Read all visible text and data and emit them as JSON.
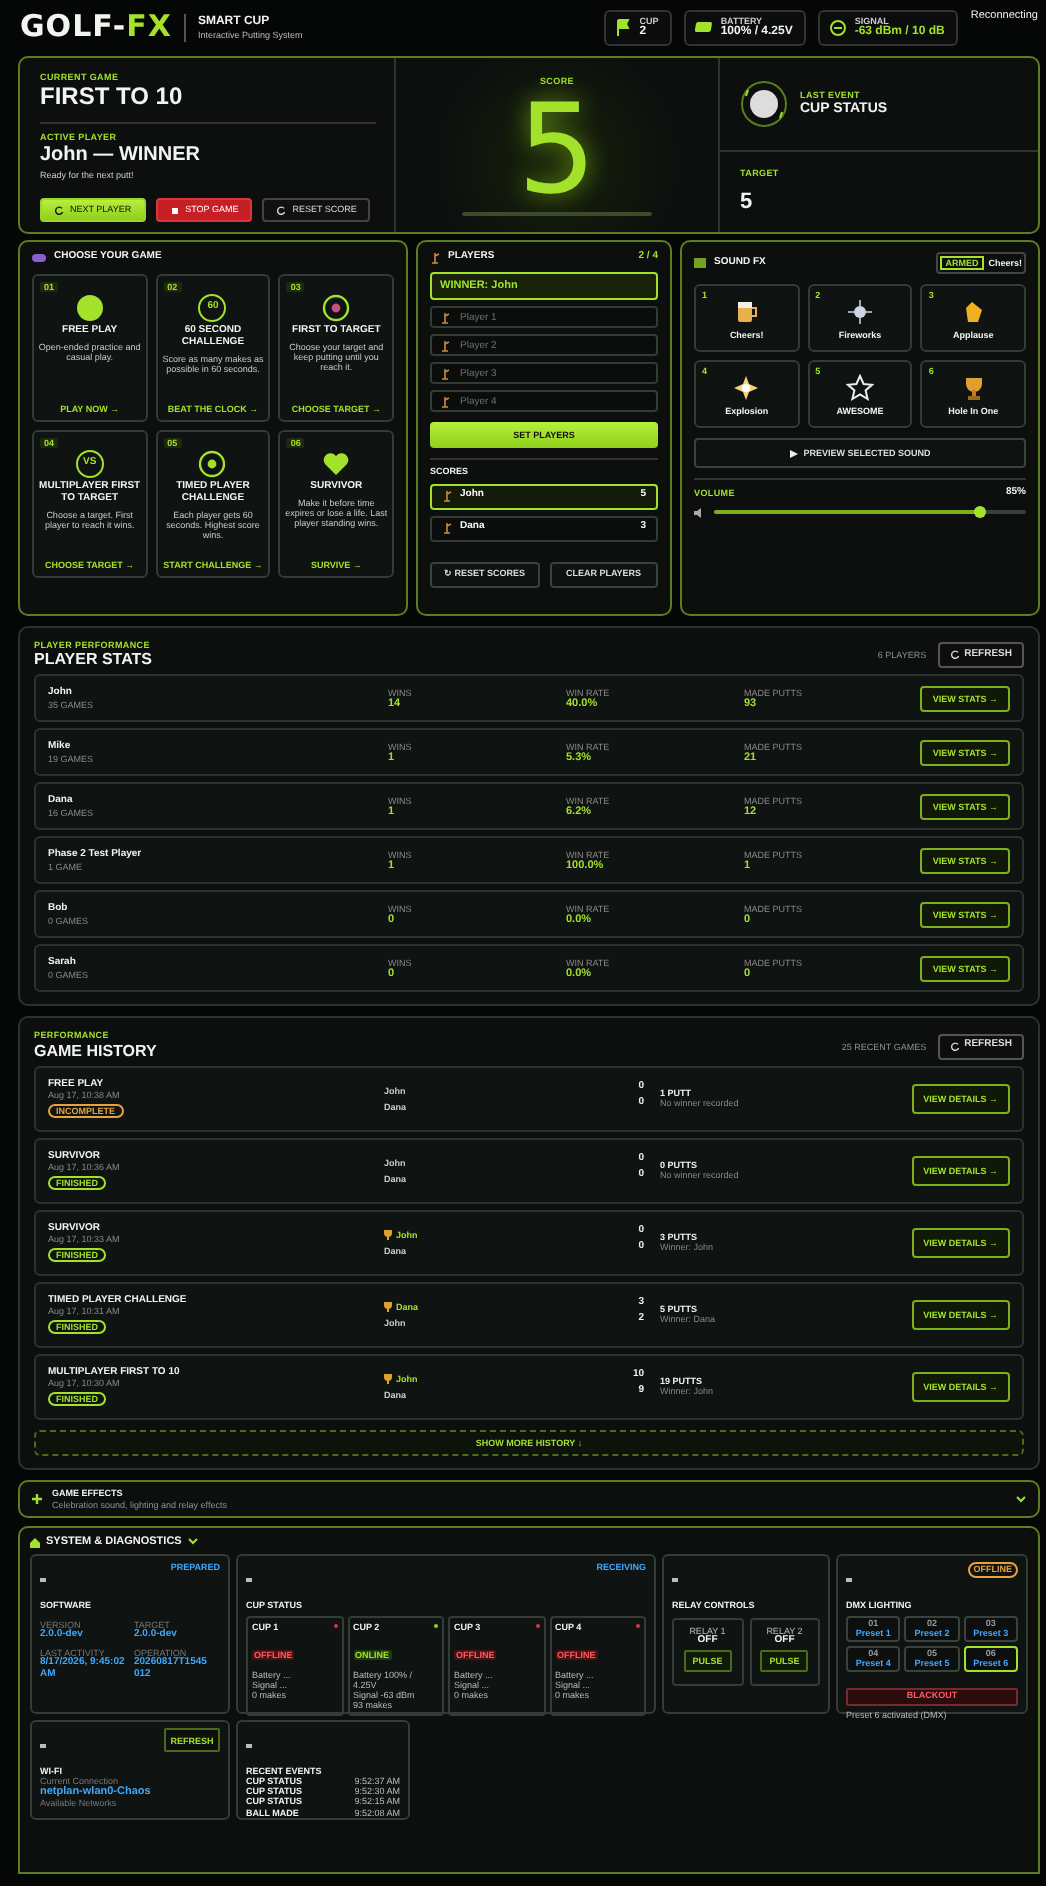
{
  "header": {
    "logo": {
      "main": "GOLF-",
      "accent": "FX"
    },
    "title": "SMART CUP",
    "subtitle": "Interactive Putting System",
    "chips": [
      {
        "kind": "flag",
        "label": "CUP",
        "value": "2"
      },
      {
        "kind": "battery",
        "label": "BATTERY",
        "value": "100% / 4.25V"
      },
      {
        "kind": "signal",
        "label": "SIGNAL",
        "value": "-63 dBm / 10 dB"
      }
    ],
    "connection": "Reconnecting"
  },
  "hero": {
    "game_label": "CURRENT GAME",
    "game": "FIRST TO 10",
    "player_label": "ACTIVE PLAYER",
    "player": "John — WINNER",
    "hint": "Ready for the next putt!",
    "buttons": [
      {
        "kind": "primary",
        "label": "NEXT PLAYER"
      },
      {
        "kind": "danger",
        "label": "STOP GAME"
      },
      {
        "kind": "outline",
        "label": "RESET SCORE"
      }
    ],
    "score_label": "SCORE",
    "score": "5",
    "event_label": "LAST EVENT",
    "event": "CUP STATUS",
    "target_label": "TARGET",
    "target": "5"
  },
  "games": {
    "title": "CHOOSE YOUR GAME",
    "cards": [
      {
        "number": "01",
        "title": "FREE PLAY",
        "description": "Open-ended practice and casual play.",
        "link": "PLAY NOW →"
      },
      {
        "number": "02",
        "icon_text": "60",
        "title": "60 SECOND CHALLENGE",
        "description": "Score as many makes as possible in 60 seconds.",
        "link": "BEAT THE CLOCK →"
      },
      {
        "number": "03",
        "title": "FIRST TO TARGET",
        "description": "Choose your target and keep putting until you reach it.",
        "link": "CHOOSE TARGET →"
      },
      {
        "number": "04",
        "icon_text": "VS",
        "title": "MULTIPLAYER FIRST TO TARGET",
        "description": "Choose a target. First player to reach it wins.",
        "link": "CHOOSE TARGET →"
      },
      {
        "number": "05",
        "title": "TIMED PLAYER CHALLENGE",
        "description": "Each player gets 60 seconds. Highest score wins.",
        "link": "START CHALLENGE →"
      },
      {
        "number": "06",
        "title": "SURVIVOR",
        "description": "Make it before time expires or lose a life. Last player standing wins.",
        "link": "SURVIVE →"
      }
    ]
  },
  "players": {
    "title": "PLAYERS",
    "count": "2 / 4",
    "winner_field": "WINNER: John",
    "inputs": [
      {
        "placeholder": "Player 1"
      },
      {
        "placeholder": "Player 2"
      },
      {
        "placeholder": "Player 3"
      },
      {
        "placeholder": "Player 4"
      }
    ],
    "set_button": "SET PLAYERS",
    "scores_label": "SCORES",
    "scores": [
      {
        "name": "John",
        "score": "5",
        "selected": true
      },
      {
        "name": "Dana",
        "score": "3",
        "selected": false
      }
    ],
    "buttons": [
      "↻ RESET SCORES",
      "CLEAR PLAYERS"
    ]
  },
  "sound": {
    "title": "SOUND FX",
    "toggle": {
      "badge": "ARMED",
      "value": "Cheers!"
    },
    "effects": [
      {
        "number": "1",
        "label": "Cheers!",
        "selected": false
      },
      {
        "number": "2",
        "label": "Fireworks",
        "selected": false
      },
      {
        "number": "3",
        "label": "Applause",
        "selected": false
      },
      {
        "number": "4",
        "label": "Explosion",
        "selected": false
      },
      {
        "number": "5",
        "label": "AWESOME",
        "selected": false
      },
      {
        "number": "6",
        "label": "Hole In One",
        "selected": false
      }
    ],
    "preview_button": "PREVIEW SELECTED SOUND",
    "volume_label": "VOLUME",
    "volume_reading": "85%",
    "level": 0.85
  },
  "player_stats": {
    "kicker": "PLAYER PERFORMANCE",
    "title": "PLAYER STATS",
    "count": "6 PLAYERS",
    "refresh": "REFRESH",
    "rows": [
      {
        "name": "John",
        "games": "35 GAMES",
        "stats": [
          {
            "label": "WINS",
            "value": "14"
          },
          {
            "label": "WIN RATE",
            "value": "40.0%"
          },
          {
            "label": "MADE PUTTS",
            "value": "93"
          }
        ],
        "button": "VIEW STATS →"
      },
      {
        "name": "Mike",
        "games": "19 GAMES",
        "stats": [
          {
            "label": "WINS",
            "value": "1"
          },
          {
            "label": "WIN RATE",
            "value": "5.3%"
          },
          {
            "label": "MADE PUTTS",
            "value": "21"
          }
        ],
        "button": "VIEW STATS →"
      },
      {
        "name": "Dana",
        "games": "16 GAMES",
        "stats": [
          {
            "label": "WINS",
            "value": "1"
          },
          {
            "label": "WIN RATE",
            "value": "6.2%"
          },
          {
            "label": "MADE PUTTS",
            "value": "12"
          }
        ],
        "button": "VIEW STATS →"
      },
      {
        "name": "Phase 2 Test Player",
        "games": "1 GAME",
        "stats": [
          {
            "label": "WINS",
            "value": "1"
          },
          {
            "label": "WIN RATE",
            "value": "100.0%"
          },
          {
            "label": "MADE PUTTS",
            "value": "1"
          }
        ],
        "button": "VIEW STATS →"
      },
      {
        "name": "Bob",
        "games": "0 GAMES",
        "stats": [
          {
            "label": "WINS",
            "value": "0"
          },
          {
            "label": "WIN RATE",
            "value": "0.0%"
          },
          {
            "label": "MADE PUTTS",
            "value": "0"
          }
        ],
        "button": "VIEW STATS →"
      },
      {
        "name": "Sarah",
        "games": "0 GAMES",
        "stats": [
          {
            "label": "WINS",
            "value": "0"
          },
          {
            "label": "WIN RATE",
            "value": "0.0%"
          },
          {
            "label": "MADE PUTTS",
            "value": "0"
          }
        ],
        "button": "VIEW STATS →"
      }
    ]
  },
  "game_history": {
    "kicker": "PERFORMANCE",
    "title": "GAME HISTORY",
    "count": "25 RECENT GAMES",
    "refresh": "REFRESH",
    "games": [
      {
        "title": "FREE PLAY",
        "time": "Aug 17, 10:38 AM",
        "status": {
          "kind": "incomplete",
          "text": "INCOMPLETE"
        },
        "players": [
          {
            "name": "John",
            "score": "0",
            "winner": false
          },
          {
            "name": "Dana",
            "score": "0",
            "winner": false
          }
        ],
        "putts": "1 PUTT",
        "result": "No winner recorded",
        "button": "VIEW DETAILS →"
      },
      {
        "title": "SURVIVOR",
        "time": "Aug 17, 10:36 AM",
        "status": {
          "kind": "finished",
          "text": "FINISHED"
        },
        "players": [
          {
            "name": "John",
            "score": "0",
            "winner": false
          },
          {
            "name": "Dana",
            "score": "0",
            "winner": false
          }
        ],
        "putts": "0 PUTTS",
        "result": "No winner recorded",
        "button": "VIEW DETAILS →"
      },
      {
        "title": "SURVIVOR",
        "time": "Aug 17, 10:33 AM",
        "status": {
          "kind": "finished",
          "text": "FINISHED"
        },
        "players": [
          {
            "name": "John",
            "score": "0",
            "winner": true
          },
          {
            "name": "Dana",
            "score": "0",
            "winner": false
          }
        ],
        "putts": "3 PUTTS",
        "result": "Winner: John",
        "button": "VIEW DETAILS →"
      },
      {
        "title": "TIMED PLAYER CHALLENGE",
        "time": "Aug 17, 10:31 AM",
        "status": {
          "kind": "finished",
          "text": "FINISHED"
        },
        "players": [
          {
            "name": "Dana",
            "score": "3",
            "winner": true
          },
          {
            "name": "John",
            "score": "2",
            "winner": false
          }
        ],
        "putts": "5 PUTTS",
        "result": "Winner: Dana",
        "button": "VIEW DETAILS →"
      },
      {
        "title": "MULTIPLAYER FIRST TO 10",
        "time": "Aug 17, 10:30 AM",
        "status": {
          "kind": "finished",
          "text": "FINISHED"
        },
        "players": [
          {
            "name": "John",
            "score": "10",
            "winner": true
          },
          {
            "name": "Dana",
            "score": "9",
            "winner": false
          }
        ],
        "putts": "19 PUTTS",
        "result": "Winner: John",
        "button": "VIEW DETAILS →"
      }
    ],
    "more_button": "SHOW MORE HISTORY ↓"
  },
  "game_effects": {
    "title": "GAME EFFECTS",
    "subtitle": "Celebration sound, lighting and relay effects",
    "expanded": false
  },
  "system": {
    "title": "SYSTEM & DIAGNOSTICS",
    "expanded": true,
    "software": {
      "title": "SOFTWARE",
      "status": "PREPARED",
      "fields": [
        {
          "label": "VERSION",
          "value": "2.0.0-dev"
        },
        {
          "label": "TARGET",
          "value": "2.0.0-dev"
        },
        {
          "label": "LAST ACTIVITY",
          "value": "8/17/2026, 9:45:02 AM"
        },
        {
          "label": "OPERATION",
          "value": "20260817T1545 012"
        }
      ]
    },
    "cups": {
      "title": "CUP STATUS",
      "status": "RECEIVING",
      "items": [
        {
          "name": "CUP 1",
          "state": "OFFLINE",
          "online": false,
          "color": "#d9363e",
          "lines": [
            "Battery ...",
            "Signal ...",
            "0 makes"
          ]
        },
        {
          "name": "CUP 2",
          "state": "ONLINE",
          "online": true,
          "color": "#8fd11f",
          "lines": [
            "Battery 100% / 4.25V",
            "Signal -63 dBm",
            "93 makes"
          ]
        },
        {
          "name": "CUP 3",
          "state": "OFFLINE",
          "online": false,
          "color": "#d9363e",
          "lines": [
            "Battery ...",
            "Signal ...",
            "0 makes"
          ]
        },
        {
          "name": "CUP 4",
          "state": "OFFLINE",
          "online": false,
          "color": "#d9363e",
          "lines": [
            "Battery ...",
            "Signal ...",
            "0 makes"
          ]
        }
      ]
    },
    "relays": {
      "title": "RELAY CONTROLS",
      "items": [
        {
          "name": "RELAY 1",
          "state": "OFF",
          "button": "PULSE"
        },
        {
          "name": "RELAY 2",
          "state": "OFF",
          "button": "PULSE"
        }
      ]
    },
    "dmx": {
      "title": "DMX LIGHTING",
      "status": "OFFLINE",
      "presets": [
        {
          "number": "01",
          "label": "Preset 1",
          "selected": false
        },
        {
          "number": "02",
          "label": "Preset 2",
          "selected": false
        },
        {
          "number": "03",
          "label": "Preset 3",
          "selected": false
        },
        {
          "number": "04",
          "label": "Preset 4",
          "selected": false
        },
        {
          "number": "05",
          "label": "Preset 5",
          "selected": false
        },
        {
          "number": "06",
          "label": "Preset 6",
          "selected": true
        }
      ],
      "blackout": "BLACKOUT",
      "note": "Preset 6 activated (DMX)"
    },
    "wifi": {
      "title": "WI-FI",
      "button": "REFRESH",
      "current_label": "Current Connection",
      "current": "netplan-wlan0-Chaos",
      "available_label": "Available Networks"
    },
    "events": {
      "title": "RECENT EVENTS",
      "items": [
        {
          "name": "CUP STATUS",
          "time": "9:52:37 AM"
        },
        {
          "name": "CUP STATUS",
          "time": "9:52:30 AM"
        },
        {
          "name": "CUP STATUS",
          "time": "9:52:15 AM"
        },
        {
          "name": "BALL MADE",
          "time": "9:52:08 AM"
        }
      ]
    }
  }
}
